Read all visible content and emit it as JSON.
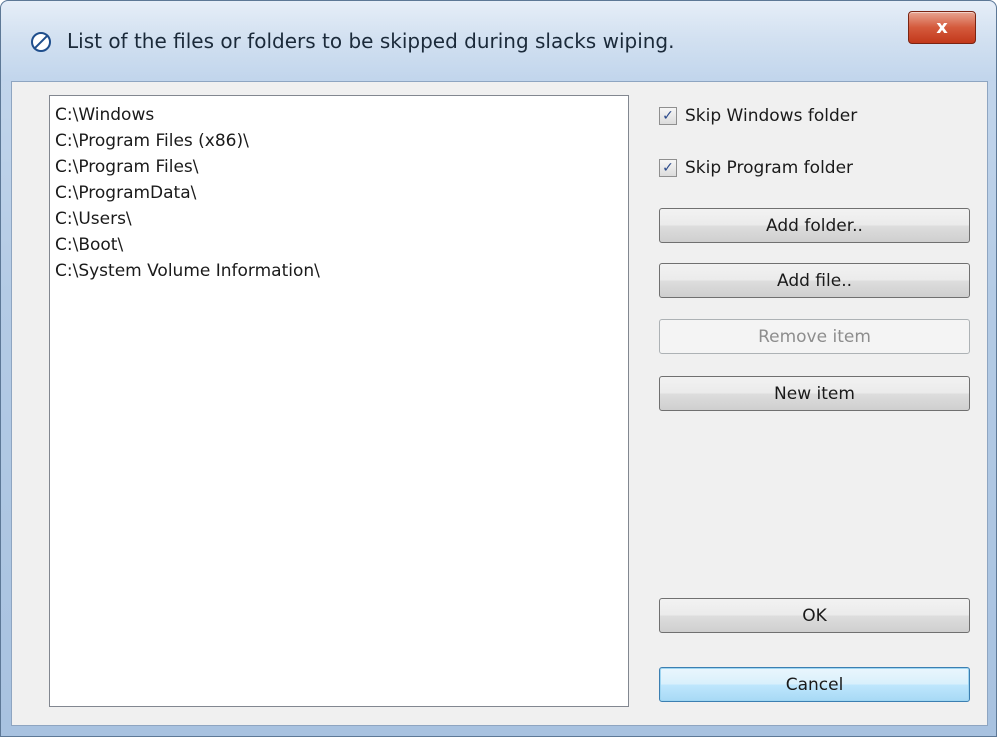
{
  "window": {
    "title": "List of the files or folders to be skipped during slacks wiping.",
    "close_label": "x",
    "icon": "no-entry-icon"
  },
  "skip_list": {
    "items": [
      "C:\\Windows",
      "C:\\Program Files (x86)\\",
      "C:\\Program Files\\",
      "C:\\ProgramData\\",
      "C:\\Users\\",
      "C:\\Boot\\",
      "C:\\System Volume Information\\"
    ]
  },
  "options": {
    "skip_windows": {
      "label": "Skip Windows folder",
      "checked": true
    },
    "skip_program": {
      "label": "Skip Program folder",
      "checked": true
    }
  },
  "buttons": {
    "add_folder": "Add folder..",
    "add_file": "Add file..",
    "remove_item": "Remove item",
    "new_item": "New item",
    "ok": "OK",
    "cancel": "Cancel"
  },
  "colors": {
    "accent": "#3c7fb1",
    "close": "#c2381b"
  }
}
